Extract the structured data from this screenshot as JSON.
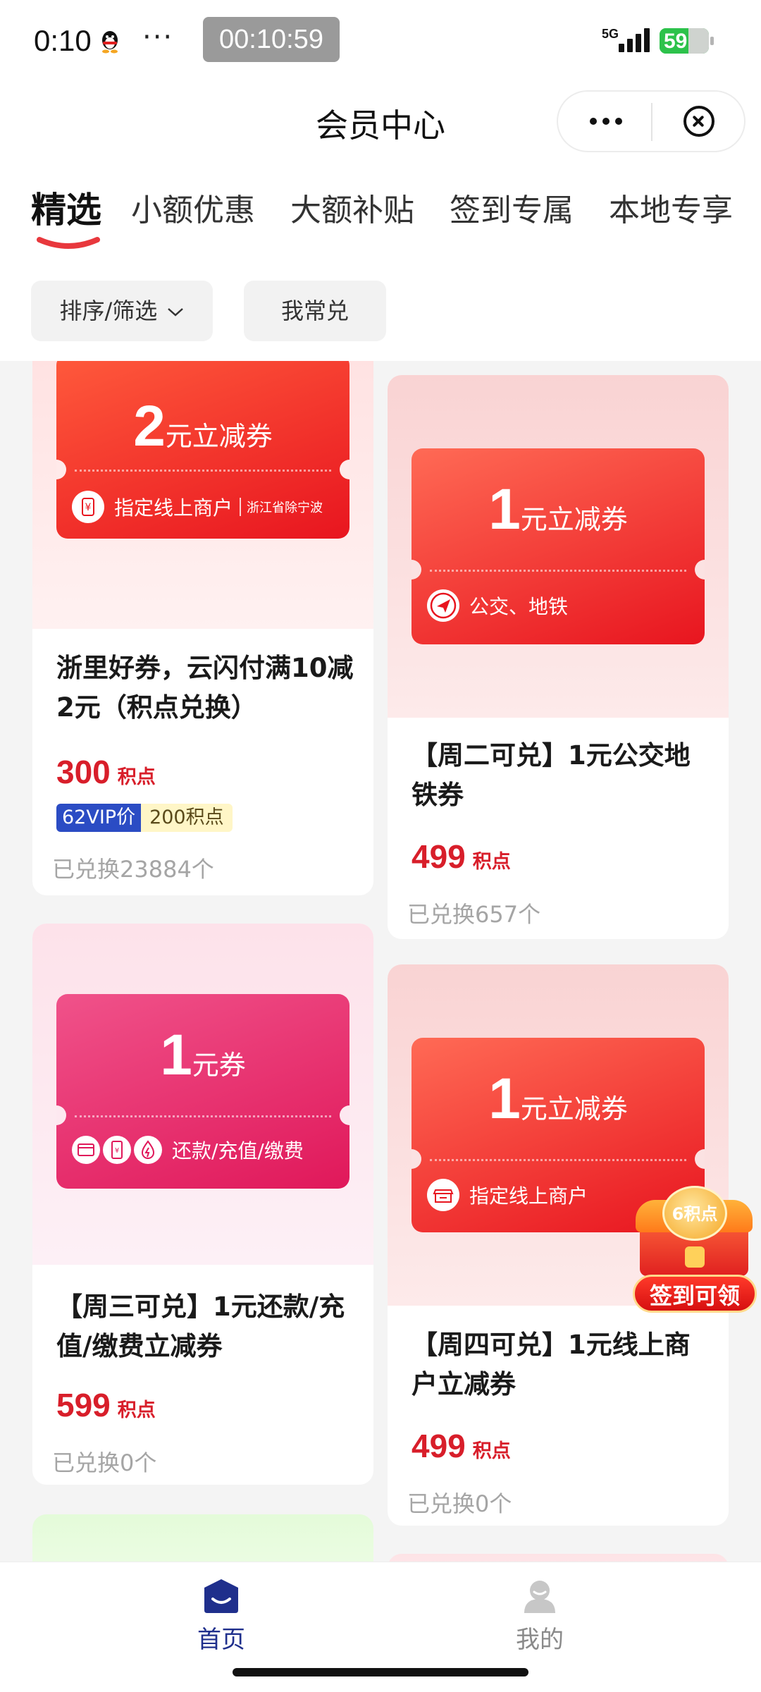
{
  "status_bar": {
    "time": "0:10",
    "dots": "···",
    "timer": "00:10:59",
    "network": "5G",
    "battery_percent": "59",
    "battery_level": 0.59
  },
  "header": {
    "title": "会员中心"
  },
  "tabs": [
    {
      "label": "精选",
      "active": true
    },
    {
      "label": "小额优惠",
      "active": false
    },
    {
      "label": "大额补贴",
      "active": false
    },
    {
      "label": "签到专属",
      "active": false
    },
    {
      "label": "本地专享",
      "active": false
    }
  ],
  "filters": {
    "sort_label": "排序/筛选",
    "favorites_label": "我常兑"
  },
  "products": [
    {
      "coupon_value": "2",
      "coupon_unit": "元立减券",
      "coupon_scope": "指定线上商户",
      "coupon_region": "浙江省除宁波",
      "title": "浙里好券，云闪付满10减2元（积点兑换）",
      "price": "300",
      "price_unit": "积点",
      "vip_label": "62VIP价",
      "vip_price": "200积点",
      "redeemed": "已兑换23884个",
      "theme": "red",
      "icon": "yuan-icon"
    },
    {
      "coupon_value": "1",
      "coupon_unit": "元立减券",
      "coupon_scope": "公交、地铁",
      "title": "【周二可兑】1元公交地铁券",
      "price": "499",
      "price_unit": "积点",
      "redeemed": "已兑换657个",
      "theme": "red",
      "icon": "navigation-arrow-icon"
    },
    {
      "coupon_value": "1",
      "coupon_unit": "元券",
      "coupon_scope": "还款/充值/缴费",
      "title": "【周三可兑】1元还款/充值/缴费立减券",
      "price": "599",
      "price_unit": "积点",
      "redeemed": "已兑换0个",
      "theme": "pink",
      "icon": "card-phone-bill-icons"
    },
    {
      "coupon_value": "1",
      "coupon_unit": "元立减券",
      "coupon_scope": "指定线上商户",
      "title": "【周四可兑】1元线上商户立减券",
      "price": "499",
      "price_unit": "积点",
      "redeemed": "已兑换0个",
      "theme": "red",
      "icon": "storefront-icon"
    }
  ],
  "sign_badge": {
    "points": "6积点",
    "label": "签到可领"
  },
  "bottom_nav": [
    {
      "label": "首页",
      "active": true,
      "icon": "home-icon",
      "color": "#1f2f8c"
    },
    {
      "label": "我的",
      "active": false,
      "icon": "profile-icon",
      "color": "#8a8a8a"
    }
  ],
  "colors": {
    "accent_red": "#d81e2a",
    "coupon_red": "#ee2a26",
    "coupon_pink": "#ea2f72",
    "nav_active": "#1f2f8c"
  }
}
